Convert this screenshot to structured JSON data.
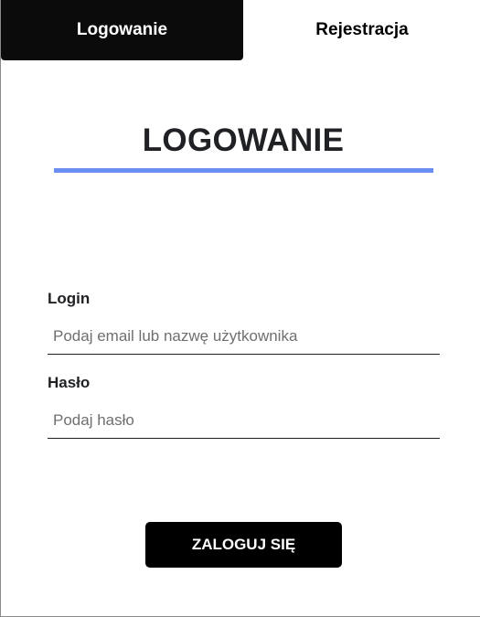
{
  "tabs": {
    "login_label": "Logowanie",
    "register_label": "Rejestracja"
  },
  "form": {
    "title": "LOGOWANIE",
    "login": {
      "label": "Login",
      "placeholder": "Podaj email lub nazwę użytkownika",
      "value": ""
    },
    "password": {
      "label": "Hasło",
      "placeholder": "Podaj hasło",
      "value": ""
    },
    "submit_label": "ZALOGUJ SIĘ"
  },
  "colors": {
    "accent": "#6b8ef2",
    "active_tab": "#0b0b0b",
    "button": "#000000"
  }
}
